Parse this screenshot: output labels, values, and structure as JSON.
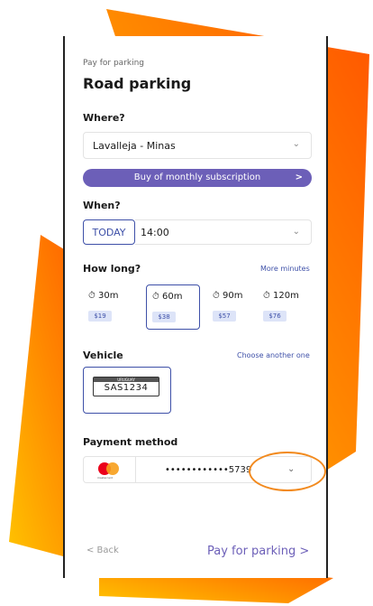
{
  "header": {
    "small_title": "Pay for parking",
    "title": "Road parking"
  },
  "where": {
    "label": "Where?",
    "location": "Lavalleja - Minas",
    "subscription_button": "Buy of monthly subscription",
    "subscription_arrow": ">"
  },
  "when": {
    "label": "When?",
    "today": "TODAY",
    "time": "14:00"
  },
  "how_long": {
    "label": "How long?",
    "more_link": "More minutes",
    "options": [
      {
        "label": "30m",
        "price": "$19"
      },
      {
        "label": "60m",
        "price": "$38"
      },
      {
        "label": "90m",
        "price": "$57"
      },
      {
        "label": "120m",
        "price": "$76"
      }
    ]
  },
  "vehicle": {
    "label": "Vehicle",
    "choose_link": "Choose another one",
    "plate_country": "URUGUAY",
    "plate": "SAS1234"
  },
  "payment": {
    "label": "Payment method",
    "card_brand": "mastercard",
    "card_number": "••••••••••••5739"
  },
  "footer": {
    "back": "< Back",
    "pay": "Pay for parking  >"
  },
  "glyphs": {
    "chevron_down": "⌄",
    "clock": "⏱"
  },
  "colors": {
    "accent": "#3e50a8",
    "purple": "#6c5fb8",
    "highlight": "#f28a1e"
  }
}
